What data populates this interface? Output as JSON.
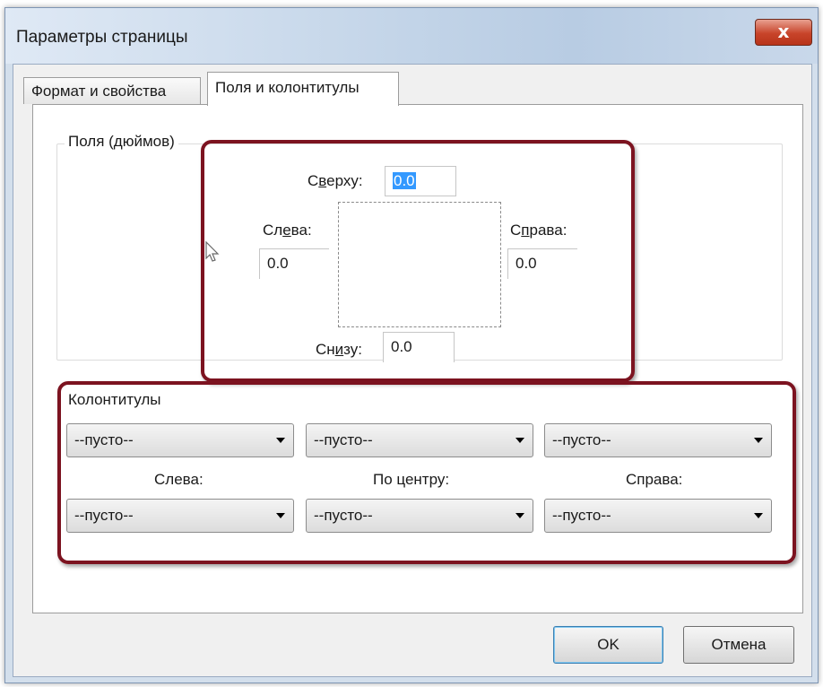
{
  "window": {
    "title": "Параметры страницы",
    "close_glyph": "x"
  },
  "tabs": [
    {
      "label": "Формат и свойства",
      "selected": false
    },
    {
      "label": "Поля и колонтитулы",
      "selected": true
    }
  ],
  "margins": {
    "group_label": "Поля (дюймов)",
    "top_label": "Сверху:",
    "top_value": "0.0",
    "left_label": "Слева:",
    "left_value": "0.0",
    "right_label": "Справа:",
    "right_value": "0.0",
    "bottom_label": "Снизу:",
    "bottom_value": "0.0"
  },
  "headers_footers": {
    "group_label": "Колонтитулы",
    "header_left": "--пусто--",
    "header_center": "--пусто--",
    "header_right": "--пусто--",
    "col_left_label": "Слева:",
    "col_center_label": "По центру:",
    "col_right_label": "Справа:",
    "footer_left": "--пусто--",
    "footer_center": "--пусто--",
    "footer_right": "--пусто--"
  },
  "buttons": {
    "ok": "OK",
    "cancel": "Отмена"
  },
  "colors": {
    "highlight_border": "#7c1320",
    "selection": "#3399ff",
    "close_button": "#c8442a"
  }
}
